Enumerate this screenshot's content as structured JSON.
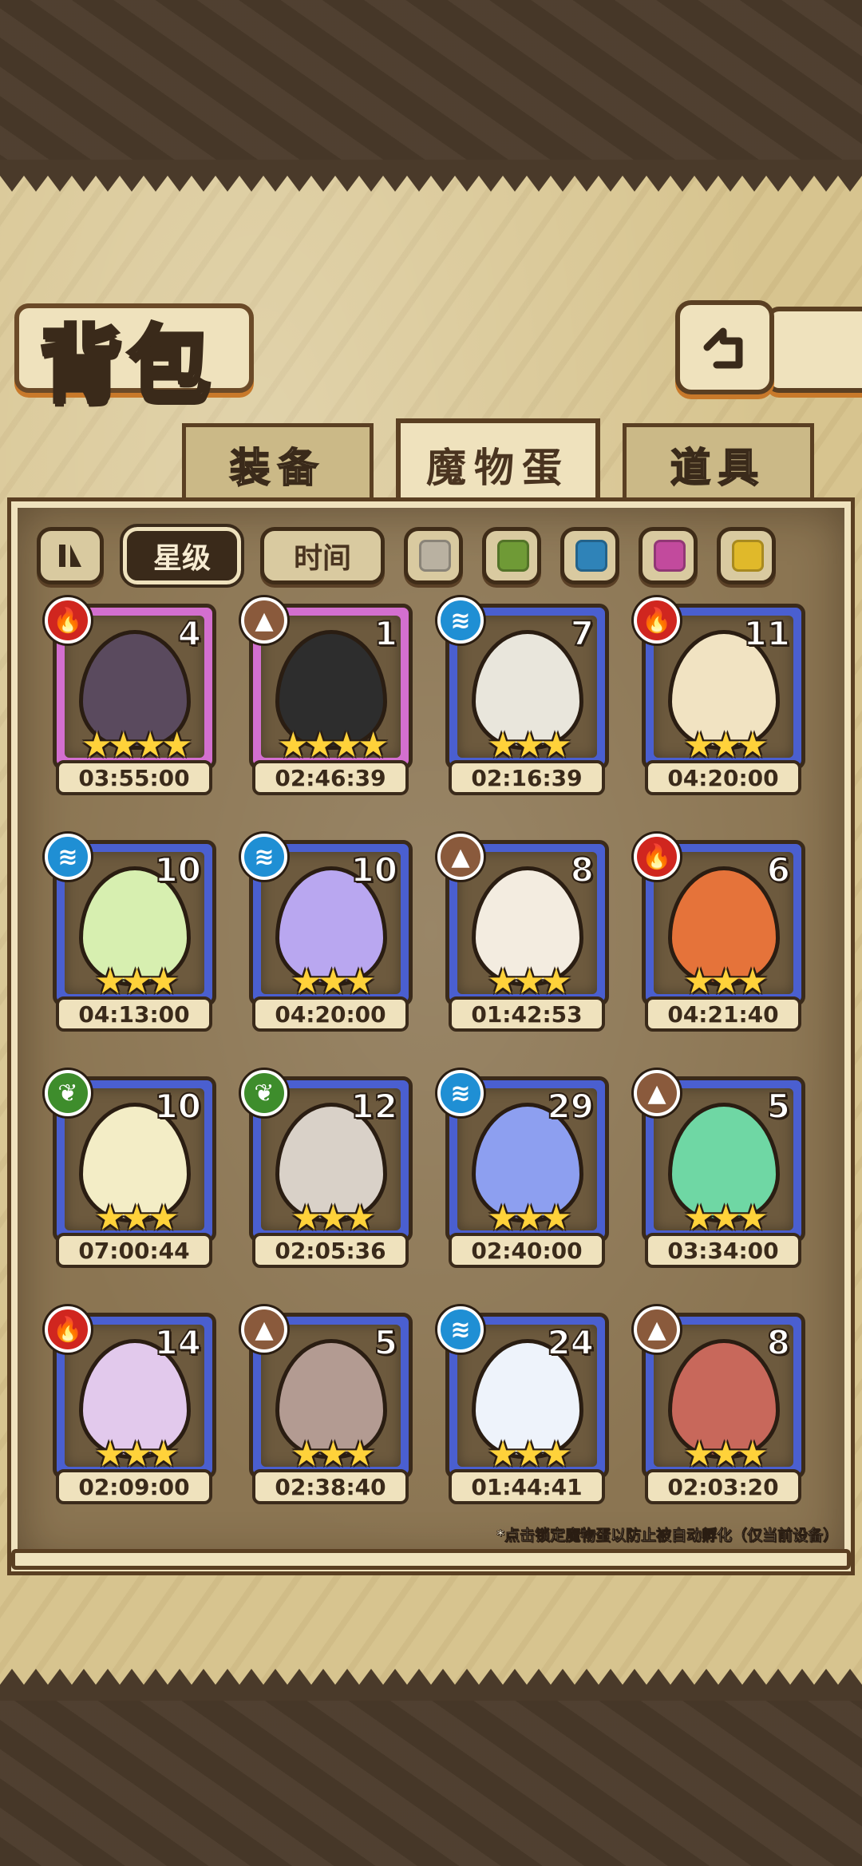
{
  "header": {
    "title": "背包"
  },
  "tabs": [
    {
      "label": "装备",
      "active": false
    },
    {
      "label": "魔物蛋",
      "active": true
    },
    {
      "label": "道具",
      "active": false
    }
  ],
  "filters": {
    "sort_star_label": "星级",
    "sort_time_label": "时间",
    "color_swatches": [
      "#b9b1a1",
      "#6f9a36",
      "#2f83b8",
      "#c24a9d",
      "#e0b92a"
    ]
  },
  "eggs": [
    {
      "element": "fire",
      "count": "4",
      "stars": "★★★★",
      "timer": "03:55:00",
      "frame": "purple",
      "egg_color": "#5a4a5e"
    },
    {
      "element": "earth",
      "count": "1",
      "stars": "★★★★",
      "timer": "02:46:39",
      "frame": "purple",
      "egg_color": "#2d2d2d"
    },
    {
      "element": "water",
      "count": "7",
      "stars": "★★★",
      "timer": "02:16:39",
      "frame": "blue",
      "egg_color": "#e9e6dc"
    },
    {
      "element": "fire",
      "count": "11",
      "stars": "★★★",
      "timer": "04:20:00",
      "frame": "blue",
      "egg_color": "#f1e3c2"
    },
    {
      "element": "water",
      "count": "10",
      "stars": "★★★",
      "timer": "04:13:00",
      "frame": "blue",
      "egg_color": "#d7efb0"
    },
    {
      "element": "water",
      "count": "10",
      "stars": "★★★",
      "timer": "04:20:00",
      "frame": "blue",
      "egg_color": "#b9a7f0"
    },
    {
      "element": "earth",
      "count": "8",
      "stars": "★★★",
      "timer": "01:42:53",
      "frame": "blue",
      "egg_color": "#f3ece0"
    },
    {
      "element": "fire",
      "count": "6",
      "stars": "★★★",
      "timer": "04:21:40",
      "frame": "blue",
      "egg_color": "#e5733a"
    },
    {
      "element": "grass",
      "count": "10",
      "stars": "★★★",
      "timer": "07:00:44",
      "frame": "blue",
      "egg_color": "#f3edc6"
    },
    {
      "element": "grass",
      "count": "12",
      "stars": "★★★",
      "timer": "02:05:36",
      "frame": "blue",
      "egg_color": "#d9d1c8"
    },
    {
      "element": "water",
      "count": "29",
      "stars": "★★★",
      "timer": "02:40:00",
      "frame": "blue",
      "egg_color": "#8d9ff0"
    },
    {
      "element": "earth",
      "count": "5",
      "stars": "★★★",
      "timer": "03:34:00",
      "frame": "blue",
      "egg_color": "#6fd7a4"
    },
    {
      "element": "fire",
      "count": "14",
      "stars": "★★★",
      "timer": "02:09:00",
      "frame": "blue",
      "egg_color": "#e2c9ec"
    },
    {
      "element": "earth",
      "count": "5",
      "stars": "★★★",
      "timer": "02:38:40",
      "frame": "blue",
      "egg_color": "#b39b92"
    },
    {
      "element": "water",
      "count": "24",
      "stars": "★★★",
      "timer": "01:44:41",
      "frame": "blue",
      "egg_color": "#eef3fb"
    },
    {
      "element": "earth",
      "count": "8",
      "stars": "★★★",
      "timer": "02:03:20",
      "frame": "blue",
      "egg_color": "#c8685b"
    }
  ],
  "element_colors": {
    "fire": "#d0261f",
    "earth": "#8a5a3c",
    "water": "#1f8fd4",
    "grass": "#3e8d2c"
  },
  "note": "*点击锁定魔物蛋以防止被自动孵化（仅当前设备）"
}
